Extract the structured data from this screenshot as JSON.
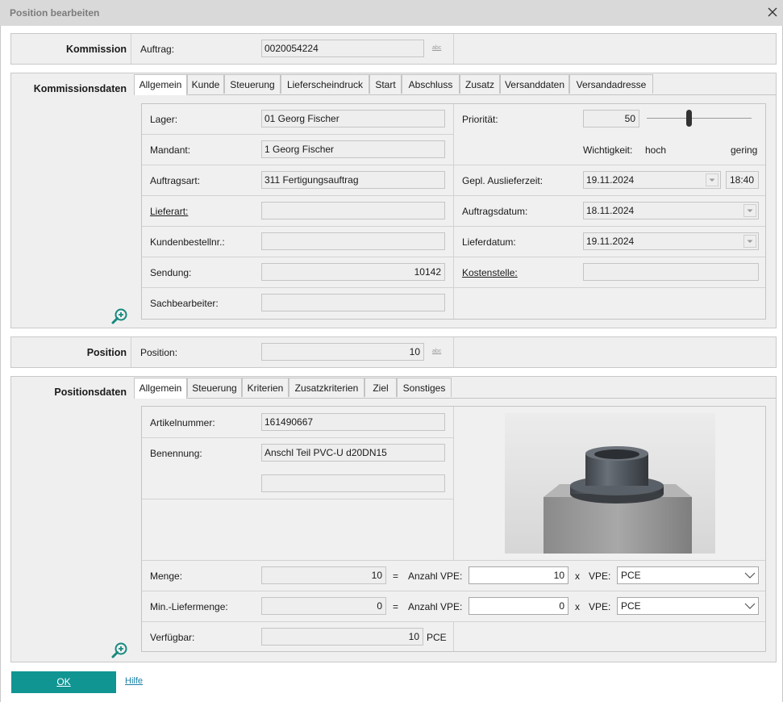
{
  "window": {
    "title": "Position bearbeiten"
  },
  "kommission": {
    "section_label": "Kommission",
    "auftrag_label": "Auftrag:",
    "auftrag_value": "0020054224",
    "abc": "abc"
  },
  "kommissionsdaten": {
    "section_label": "Kommissionsdaten",
    "tabs": [
      "Allgemein",
      "Kunde",
      "Steuerung",
      "Lieferscheindruck",
      "Start",
      "Abschluss",
      "Zusatz",
      "Versanddaten",
      "Versandadresse"
    ],
    "lager_label": "Lager:",
    "lager_value": "01 Georg Fischer",
    "mandant_label": "Mandant:",
    "mandant_value": "1  Georg Fischer",
    "auftragsart_label": "Auftragsart:",
    "auftragsart_value": "311  Fertigungsauftrag",
    "lieferart_label": "Lieferart:",
    "lieferart_value": "",
    "kundenbestell_label": "Kundenbestellnr.:",
    "kundenbestell_value": "",
    "sendung_label": "Sendung:",
    "sendung_value": "10142",
    "sachbearbeiter_label": "Sachbearbeiter:",
    "sachbearbeiter_value": "",
    "prioritaet_label": "Priorität:",
    "prioritaet_value": "50",
    "prioritaet_level": 0.4,
    "wichtigkeit_label": "Wichtigkeit:",
    "hoch_label": "hoch",
    "gering_label": "gering",
    "gepl_label": "Gepl. Auslieferzeit:",
    "gepl_date": "19.11.2024",
    "gepl_time": "18:40",
    "auftragsdatum_label": "Auftragsdatum:",
    "auftragsdatum_value": "18.11.2024",
    "lieferdatum_label": "Lieferdatum:",
    "lieferdatum_value": "19.11.2024",
    "kostenstelle_label": "Kostenstelle:",
    "kostenstelle_value": ""
  },
  "position": {
    "section_label": "Position",
    "position_label": "Position:",
    "position_value": "10",
    "abc": "abc"
  },
  "positionsdaten": {
    "section_label": "Positionsdaten",
    "tabs": [
      "Allgemein",
      "Steuerung",
      "Kriterien",
      "Zusatzkriterien",
      "Ziel",
      "Sonstiges"
    ],
    "artikelnummer_label": "Artikelnummer:",
    "artikelnummer_value": "161490667",
    "benennung_label": "Benennung:",
    "benennung_value": "Anschl Teil PVC-U d20DN15",
    "benennung_value2": "",
    "menge_label": "Menge:",
    "menge_value": "10",
    "eq": "=",
    "anzahl_vpe_label": "Anzahl VPE:",
    "menge_anzahl": "10",
    "x": "x",
    "vpe_label": "VPE:",
    "menge_vpe": "PCE",
    "minliefer_label": "Min.-Liefermenge:",
    "minliefer_value": "0",
    "minliefer_anzahl": "0",
    "minliefer_vpe": "PCE",
    "verfuegbar_label": "Verfügbar:",
    "verfuegbar_value": "10",
    "verfuegbar_unit": "PCE"
  },
  "footer": {
    "ok_label": "OK",
    "help_label": "Hilfe"
  },
  "colors": {
    "accent": "#109593",
    "link": "#1a7fa8",
    "zoom_icon": "#16897f"
  },
  "icons": [
    "close-icon",
    "zoom-in-icon",
    "dropdown-arrow-icon",
    "chevron-down-icon"
  ]
}
